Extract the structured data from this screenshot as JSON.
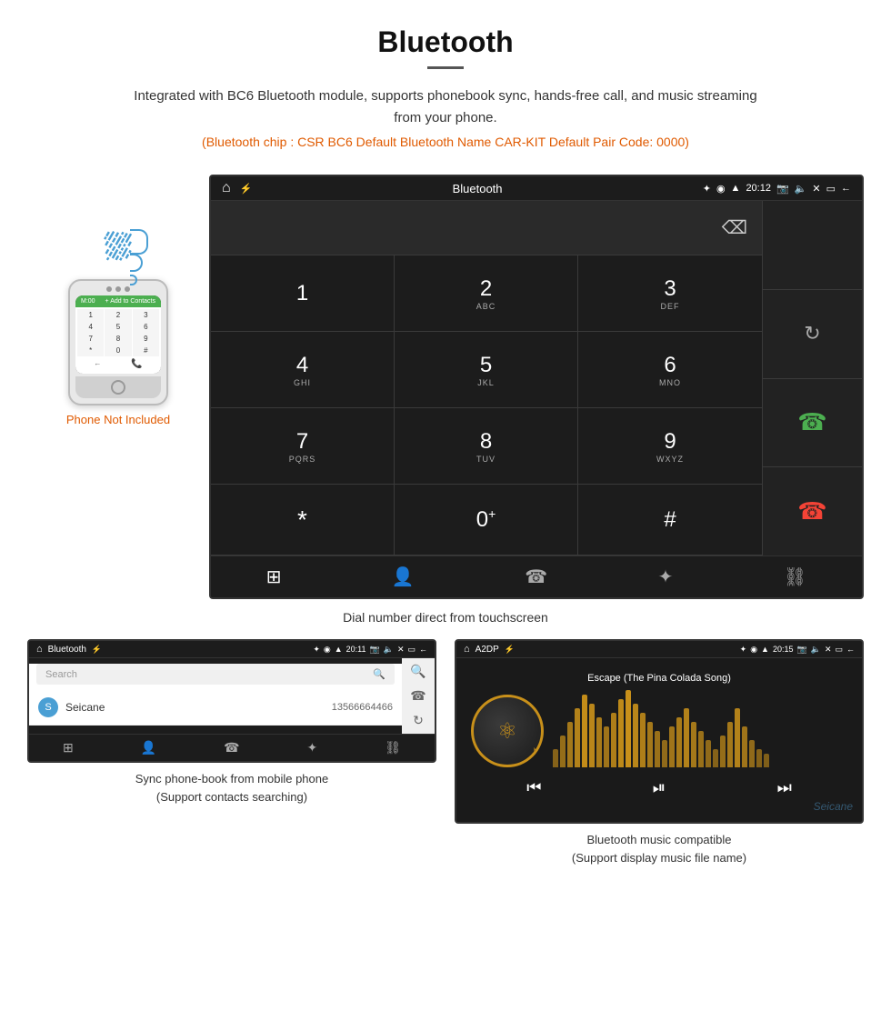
{
  "header": {
    "title": "Bluetooth",
    "description": "Integrated with BC6 Bluetooth module, supports phonebook sync, hands-free call, and music streaming from your phone.",
    "specs": "(Bluetooth chip : CSR BC6   Default Bluetooth Name CAR-KIT    Default Pair Code: 0000)"
  },
  "large_screen": {
    "status_bar": {
      "app_name": "Bluetooth",
      "time": "20:12"
    },
    "dial_keys": [
      {
        "main": "1",
        "sub": ""
      },
      {
        "main": "2",
        "sub": "ABC"
      },
      {
        "main": "3",
        "sub": "DEF"
      },
      {
        "main": "4",
        "sub": "GHI"
      },
      {
        "main": "5",
        "sub": "JKL"
      },
      {
        "main": "6",
        "sub": "MNO"
      },
      {
        "main": "7",
        "sub": "PQRS"
      },
      {
        "main": "8",
        "sub": "TUV"
      },
      {
        "main": "9",
        "sub": "WXYZ"
      },
      {
        "main": "*",
        "sub": ""
      },
      {
        "main": "0",
        "sub": "+"
      },
      {
        "main": "#",
        "sub": ""
      }
    ],
    "caption": "Dial number direct from touchscreen"
  },
  "phonebook_screen": {
    "status_bar": {
      "app_name": "Bluetooth",
      "time": "20:11"
    },
    "search_placeholder": "Search",
    "contacts": [
      {
        "initial": "S",
        "name": "Seicane",
        "number": "13566664466"
      }
    ],
    "caption_line1": "Sync phone-book from mobile phone",
    "caption_line2": "(Support contacts searching)"
  },
  "music_screen": {
    "status_bar": {
      "app_name": "A2DP",
      "time": "20:15"
    },
    "song_title": "Escape (The Pina Colada Song)",
    "eq_bars": [
      20,
      35,
      50,
      65,
      80,
      70,
      55,
      45,
      60,
      75,
      85,
      70,
      60,
      50,
      40,
      30,
      45,
      55,
      65,
      50,
      40,
      30,
      20,
      35,
      50,
      65,
      45,
      30,
      20,
      15
    ],
    "caption_line1": "Bluetooth music compatible",
    "caption_line2": "(Support display music file name)"
  },
  "phone_mockup": {
    "not_included_text": "Phone Not Included"
  },
  "icons": {
    "home": "⌂",
    "bluetooth": "Ψ",
    "usb": "⚡",
    "wifi": "▼",
    "signal": "▲",
    "camera": "📷",
    "volume": "🔊",
    "close": "✕",
    "window": "▭",
    "back": "←",
    "call_green": "📞",
    "call_red": "📵",
    "search": "🔍",
    "contact": "👤",
    "phone": "📱",
    "reload": "↻",
    "grid": "⊞",
    "link": "⛓",
    "delete": "⌫",
    "prev": "⏮",
    "play_pause": "⏯",
    "next": "⏭"
  },
  "colors": {
    "accent_orange": "#e05a00",
    "screen_bg": "#1c1c1c",
    "key_border": "#3a3a3a",
    "call_green": "#4caf50",
    "call_red": "#f44336",
    "gold": "#c8901a"
  }
}
